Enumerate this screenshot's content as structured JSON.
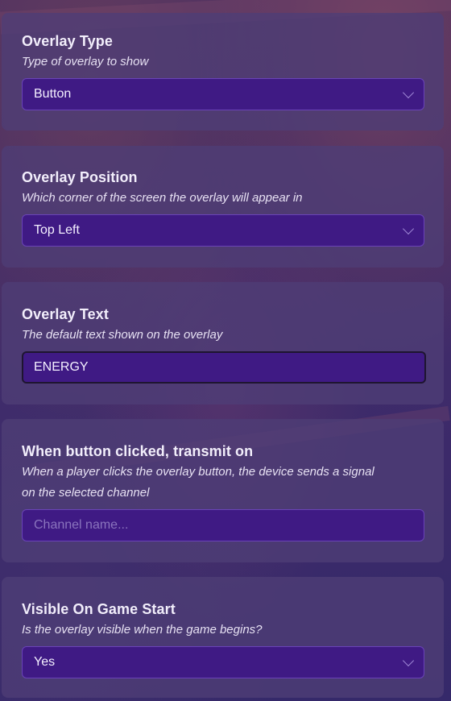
{
  "settings": [
    {
      "title": "Overlay Type",
      "description": "Type of overlay to show",
      "value": "Button"
    },
    {
      "title": "Overlay Position",
      "description": "Which corner of the screen the overlay will appear in",
      "value": "Top Left"
    },
    {
      "title": "Overlay Text",
      "description": "The default text shown on the overlay",
      "value": "ENERGY"
    },
    {
      "title": "When button clicked, transmit on",
      "description_line1": "When a player clicks the overlay button, the device sends a signal",
      "description_line2": "on the selected channel",
      "value": "",
      "placeholder": "Channel name..."
    },
    {
      "title": "Visible On Game Start",
      "description": "Is the overlay visible when the game begins?",
      "value": "Yes"
    }
  ],
  "icons": {
    "dropdown": "chevron-down-icon"
  },
  "colors": {
    "panel": "#4e3e76",
    "field_bg": "#3f1a84",
    "field_border": "#6a43b8",
    "text": "#f2eefb",
    "placeholder": "#8a74bd"
  }
}
